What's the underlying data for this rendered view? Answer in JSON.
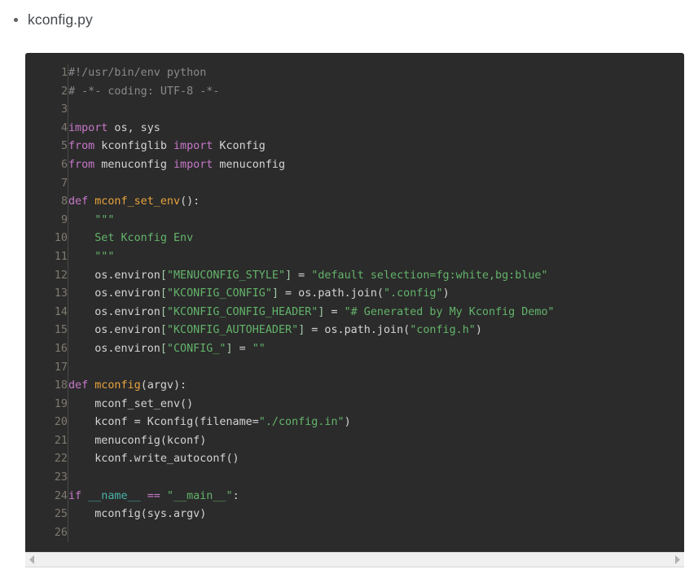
{
  "document": {
    "list": [
      {
        "label": "kconfig.py"
      }
    ]
  },
  "code_block": {
    "language": "python",
    "filename": "kconfig.py",
    "theme": {
      "background": "#2b2b2b",
      "gutter_text": "#7f7a70",
      "default_text": "#d4d4d4",
      "comment": "#8a8a8a",
      "keyword": "#c678c9",
      "function": "#e8a33d",
      "string": "#63b36a",
      "builtin": "#4ab3a8",
      "punctuation": "#a5c8a8"
    },
    "first_line_number": 1,
    "last_line_number": 26,
    "lines": [
      {
        "n": "1",
        "text": "#!/usr/bin/env python"
      },
      {
        "n": "2",
        "text": "# -*- coding: UTF-8 -*-"
      },
      {
        "n": "3",
        "text": ""
      },
      {
        "n": "4",
        "text": "import os, sys"
      },
      {
        "n": "5",
        "text": "from kconfiglib import Kconfig"
      },
      {
        "n": "6",
        "text": "from menuconfig import menuconfig"
      },
      {
        "n": "7",
        "text": ""
      },
      {
        "n": "8",
        "text": "def mconf_set_env():"
      },
      {
        "n": "9",
        "text": "    \"\"\""
      },
      {
        "n": "10",
        "text": "    Set Kconfig Env"
      },
      {
        "n": "11",
        "text": "    \"\"\""
      },
      {
        "n": "12",
        "text": "    os.environ[\"MENUCONFIG_STYLE\"] = \"default selection=fg:white,bg:blue\""
      },
      {
        "n": "13",
        "text": "    os.environ[\"KCONFIG_CONFIG\"] = os.path.join(\".config\")"
      },
      {
        "n": "14",
        "text": "    os.environ[\"KCONFIG_CONFIG_HEADER\"] = \"# Generated by My Kconfig Demo\""
      },
      {
        "n": "15",
        "text": "    os.environ[\"KCONFIG_AUTOHEADER\"] = os.path.join(\"config.h\")"
      },
      {
        "n": "16",
        "text": "    os.environ[\"CONFIG_\"] = \"\""
      },
      {
        "n": "17",
        "text": ""
      },
      {
        "n": "18",
        "text": "def mconfig(argv):"
      },
      {
        "n": "19",
        "text": "    mconf_set_env()"
      },
      {
        "n": "20",
        "text": "    kconf = Kconfig(filename=\"./config.in\")"
      },
      {
        "n": "21",
        "text": "    menuconfig(kconf)"
      },
      {
        "n": "22",
        "text": "    kconf.write_autoconf()"
      },
      {
        "n": "23",
        "text": ""
      },
      {
        "n": "24",
        "text": "if __name__ == \"__main__\":"
      },
      {
        "n": "25",
        "text": "    mconfig(sys.argv)"
      },
      {
        "n": "26",
        "text": ""
      }
    ],
    "tokens": [
      [
        {
          "c": "t-com",
          "s": "#!/usr/bin/env python"
        }
      ],
      [
        {
          "c": "t-com",
          "s": "# -*- coding: UTF-8 -*-"
        }
      ],
      [
        {
          "c": "t-var",
          "s": ""
        }
      ],
      [
        {
          "c": "t-kw",
          "s": "import"
        },
        {
          "c": "t-var",
          "s": " os, sys"
        }
      ],
      [
        {
          "c": "t-kw",
          "s": "from"
        },
        {
          "c": "t-var",
          "s": " kconfiglib "
        },
        {
          "c": "t-kw",
          "s": "import"
        },
        {
          "c": "t-var",
          "s": " Kconfig"
        }
      ],
      [
        {
          "c": "t-kw",
          "s": "from"
        },
        {
          "c": "t-var",
          "s": " menuconfig "
        },
        {
          "c": "t-kw",
          "s": "import"
        },
        {
          "c": "t-var",
          "s": " menuconfig"
        }
      ],
      [
        {
          "c": "t-var",
          "s": ""
        }
      ],
      [
        {
          "c": "t-kw",
          "s": "def"
        },
        {
          "c": "t-var",
          "s": " "
        },
        {
          "c": "t-fn",
          "s": "mconf_set_env"
        },
        {
          "c": "t-var",
          "s": "():"
        }
      ],
      [
        {
          "c": "t-var",
          "s": "    "
        },
        {
          "c": "t-doc",
          "s": "\"\"\""
        }
      ],
      [
        {
          "c": "t-var",
          "s": "    "
        },
        {
          "c": "t-doc",
          "s": "Set Kconfig Env"
        }
      ],
      [
        {
          "c": "t-var",
          "s": "    "
        },
        {
          "c": "t-doc",
          "s": "\"\"\""
        }
      ],
      [
        {
          "c": "t-var",
          "s": "    os.environ"
        },
        {
          "c": "t-pun",
          "s": "["
        },
        {
          "c": "t-str",
          "s": "\"MENUCONFIG_STYLE\""
        },
        {
          "c": "t-pun",
          "s": "]"
        },
        {
          "c": "t-var",
          "s": " = "
        },
        {
          "c": "t-str",
          "s": "\"default selection=fg:white,bg:blue\""
        }
      ],
      [
        {
          "c": "t-var",
          "s": "    os.environ"
        },
        {
          "c": "t-pun",
          "s": "["
        },
        {
          "c": "t-str",
          "s": "\"KCONFIG_CONFIG\""
        },
        {
          "c": "t-pun",
          "s": "]"
        },
        {
          "c": "t-var",
          "s": " = os.path.join("
        },
        {
          "c": "t-str",
          "s": "\".config\""
        },
        {
          "c": "t-var",
          "s": ")"
        }
      ],
      [
        {
          "c": "t-var",
          "s": "    os.environ"
        },
        {
          "c": "t-pun",
          "s": "["
        },
        {
          "c": "t-str",
          "s": "\"KCONFIG_CONFIG_HEADER\""
        },
        {
          "c": "t-pun",
          "s": "]"
        },
        {
          "c": "t-var",
          "s": " = "
        },
        {
          "c": "t-str",
          "s": "\"# Generated by My Kconfig Demo\""
        }
      ],
      [
        {
          "c": "t-var",
          "s": "    os.environ"
        },
        {
          "c": "t-pun",
          "s": "["
        },
        {
          "c": "t-str",
          "s": "\"KCONFIG_AUTOHEADER\""
        },
        {
          "c": "t-pun",
          "s": "]"
        },
        {
          "c": "t-var",
          "s": " = os.path.join("
        },
        {
          "c": "t-str",
          "s": "\"config.h\""
        },
        {
          "c": "t-var",
          "s": ")"
        }
      ],
      [
        {
          "c": "t-var",
          "s": "    os.environ"
        },
        {
          "c": "t-pun",
          "s": "["
        },
        {
          "c": "t-str",
          "s": "\"CONFIG_\""
        },
        {
          "c": "t-pun",
          "s": "]"
        },
        {
          "c": "t-var",
          "s": " = "
        },
        {
          "c": "t-str",
          "s": "\"\""
        }
      ],
      [
        {
          "c": "t-var",
          "s": ""
        }
      ],
      [
        {
          "c": "t-kw",
          "s": "def"
        },
        {
          "c": "t-var",
          "s": " "
        },
        {
          "c": "t-fn",
          "s": "mconfig"
        },
        {
          "c": "t-var",
          "s": "(argv):"
        }
      ],
      [
        {
          "c": "t-var",
          "s": "    mconf_set_env()"
        }
      ],
      [
        {
          "c": "t-var",
          "s": "    kconf = Kconfig(filename="
        },
        {
          "c": "t-str",
          "s": "\"./config.in\""
        },
        {
          "c": "t-var",
          "s": ")"
        }
      ],
      [
        {
          "c": "t-var",
          "s": "    menuconfig(kconf)"
        }
      ],
      [
        {
          "c": "t-var",
          "s": "    kconf.write_autoconf()"
        }
      ],
      [
        {
          "c": "t-var",
          "s": ""
        }
      ],
      [
        {
          "c": "t-kw",
          "s": "if"
        },
        {
          "c": "t-var",
          "s": " "
        },
        {
          "c": "t-bi",
          "s": "__name__"
        },
        {
          "c": "t-var",
          "s": " "
        },
        {
          "c": "t-kw2",
          "s": "=="
        },
        {
          "c": "t-var",
          "s": " "
        },
        {
          "c": "t-str",
          "s": "\"__main__\""
        },
        {
          "c": "t-var",
          "s": ":"
        }
      ],
      [
        {
          "c": "t-var",
          "s": "    mconfig(sys.argv)"
        }
      ],
      [
        {
          "c": "t-var",
          "s": ""
        }
      ]
    ]
  },
  "scrollbar": {
    "orientation": "horizontal",
    "left_arrow": "scroll-left",
    "right_arrow": "scroll-right"
  }
}
